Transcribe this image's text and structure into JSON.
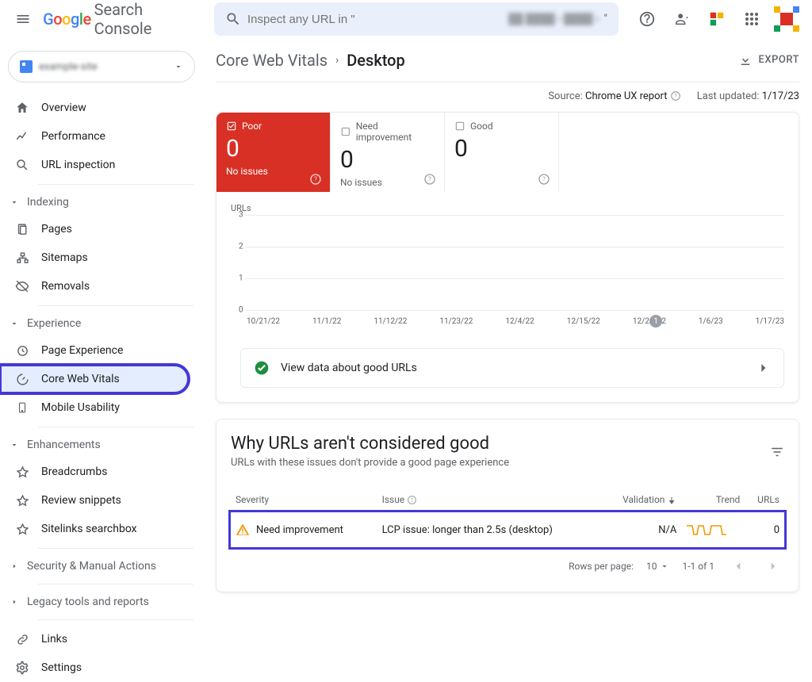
{
  "header": {
    "product_name": "Search Console",
    "search_placeholder": "Inspect any URL in \"",
    "property_label_blurred": "example-site"
  },
  "breadcrumb": {
    "parent": "Core Web Vitals",
    "current": "Desktop",
    "export": "EXPORT"
  },
  "source": {
    "label": "Source:",
    "value": "Chrome UX report",
    "updated_label": "Last updated:",
    "updated_value": "1/17/23"
  },
  "sidebar": {
    "overview": "Overview",
    "performance": "Performance",
    "url_inspection": "URL inspection",
    "indexing": "Indexing",
    "pages": "Pages",
    "sitemaps": "Sitemaps",
    "removals": "Removals",
    "experience": "Experience",
    "page_experience": "Page Experience",
    "core_web_vitals": "Core Web Vitals",
    "mobile_usability": "Mobile Usability",
    "enhancements": "Enhancements",
    "breadcrumbs": "Breadcrumbs",
    "review_snippets": "Review snippets",
    "sitelinks_searchbox": "Sitelinks searchbox",
    "security": "Security & Manual Actions",
    "legacy": "Legacy tools and reports",
    "links": "Links",
    "settings": "Settings"
  },
  "status_tabs": {
    "poor": {
      "label": "Poor",
      "value": "0",
      "sub": "No issues"
    },
    "ni": {
      "label": "Need improvement",
      "value": "0",
      "sub": "No issues"
    },
    "good": {
      "label": "Good",
      "value": "0",
      "sub": ""
    }
  },
  "chart_data": {
    "type": "line",
    "title": "URLs",
    "y_ticks": [
      0,
      1,
      2,
      3
    ],
    "ylim": [
      0,
      3
    ],
    "x_ticks": [
      "10/21/22",
      "11/1/22",
      "11/12/22",
      "11/23/22",
      "12/4/22",
      "12/15/22",
      "12/26/22",
      "1/6/23",
      "1/17/23"
    ],
    "annotation": {
      "x_index": 6,
      "label": "1"
    },
    "series": []
  },
  "good_urls_row": "View data about good URLs",
  "issues": {
    "title": "Why URLs aren't considered good",
    "subtitle": "URLs with these issues don't provide a good page experience",
    "cols": {
      "severity": "Severity",
      "issue": "Issue",
      "validation": "Validation",
      "trend": "Trend",
      "urls": "URLs"
    },
    "rows": [
      {
        "severity": "Need improvement",
        "issue": "LCP issue: longer than 2.5s (desktop)",
        "validation": "N/A",
        "urls": "0"
      }
    ],
    "pager": {
      "rpp_label": "Rows per page:",
      "rpp_value": "10",
      "range": "1-1 of 1"
    }
  }
}
